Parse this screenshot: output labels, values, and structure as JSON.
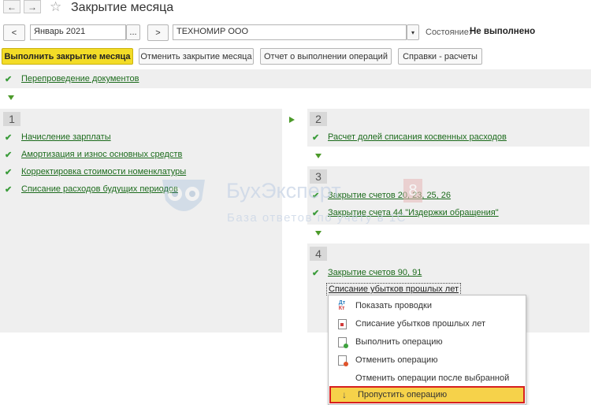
{
  "window": {
    "title": "Закрытие месяца"
  },
  "toolbar": {
    "back": "←",
    "forward": "→",
    "star": "☆",
    "prev": "<",
    "next": ">",
    "period": "Январь 2021",
    "period_btn": "...",
    "org": "ТЕХНОМИР ООО",
    "state_label": "Состояние:",
    "state_value": "Не выполнено"
  },
  "actions": {
    "run": "Выполнить закрытие месяца",
    "cancel": "Отменить закрытие месяца",
    "report": "Отчет о выполнении операций",
    "refs": "Справки - расчеты"
  },
  "top_link": "Перепроведение документов",
  "stage1": {
    "num": "1",
    "items": [
      "Начисление зарплаты",
      "Амортизация и износ основных средств",
      "Корректировка стоимости номенклатуры",
      "Списание расходов будущих периодов"
    ]
  },
  "stage2": {
    "num": "2",
    "items": [
      "Расчет долей списания косвенных расходов"
    ]
  },
  "stage3": {
    "num": "3",
    "items": [
      "Закрытие счетов 20, 23, 25, 26",
      "Закрытие счета 44 \"Издержки обращения\""
    ]
  },
  "stage4": {
    "num": "4",
    "items": [
      "Закрытие счетов 90, 91"
    ],
    "focused": "Списание убытков прошлых лет"
  },
  "watermark": {
    "brand": "БухЭксперт",
    "num": "8",
    "tagline": "База ответов по учету в 1С"
  },
  "menu": {
    "items": [
      {
        "label": "Показать проводки",
        "icon": "dt-kt-icon"
      },
      {
        "label": "Списание убытков прошлых лет",
        "icon": "document-icon"
      },
      {
        "label": "Выполнить операцию",
        "icon": "run-icon"
      },
      {
        "label": "Отменить операцию",
        "icon": "cancel-icon"
      },
      {
        "label": "Отменить операции после выбранной",
        "icon": ""
      },
      {
        "label": "Пропустить операцию",
        "icon": "skip-arrow-icon"
      }
    ],
    "highlight_color": "#f6d24a",
    "outline_color": "#d62020"
  }
}
